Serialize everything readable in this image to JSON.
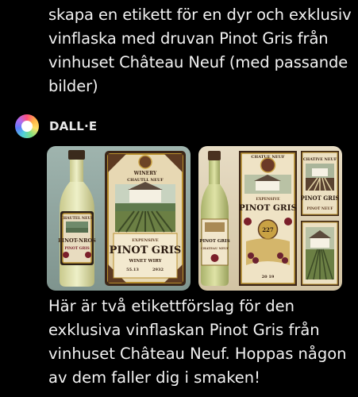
{
  "user_message": {
    "text": "skapa en etikett för en dyr och exklusiv vinflaska med druvan Pinot Gris från vinhuset Château Neuf (med passande bilder)"
  },
  "assistant": {
    "name": "DALL·E",
    "avatar_icon": "openai-avatar-icon",
    "images": [
      {
        "alt": "Generated wine label image 1",
        "bottle_label_line1": "CHAUTEL NEUF",
        "bottle_label_line2": "PINOT-NROS",
        "bottle_label_line3": "PINOT GRIS",
        "panel_heading1": "WINERY",
        "panel_heading2": "CHAUTLL NEUF",
        "panel_subtitle": "EXPENSIVE",
        "panel_title": "PINOT GRIS",
        "panel_line1": "WINET WIRY",
        "panel_line2": "55.13",
        "panel_line3": "2932"
      },
      {
        "alt": "Generated wine label image 2",
        "bottle_label": "PINOT GRIS",
        "bottle_sub": "CHATEAU NEUF",
        "center_top": "CHATUE NEUF",
        "center_sub": "EXPENSIVE",
        "center_title": "PINOT GRIS",
        "center_badge": "227",
        "center_foot": "20 19",
        "right_top": "CHATIVE NEUF",
        "right_title": "PINOT GRIS",
        "right_sub": "PINOT NEUF"
      }
    ],
    "text": "Här är två etikettförslag för den exklusiva vinflaskan Pinot Gris från vinhuset Château Neuf. Hoppas någon av dem faller dig i smaken!"
  }
}
